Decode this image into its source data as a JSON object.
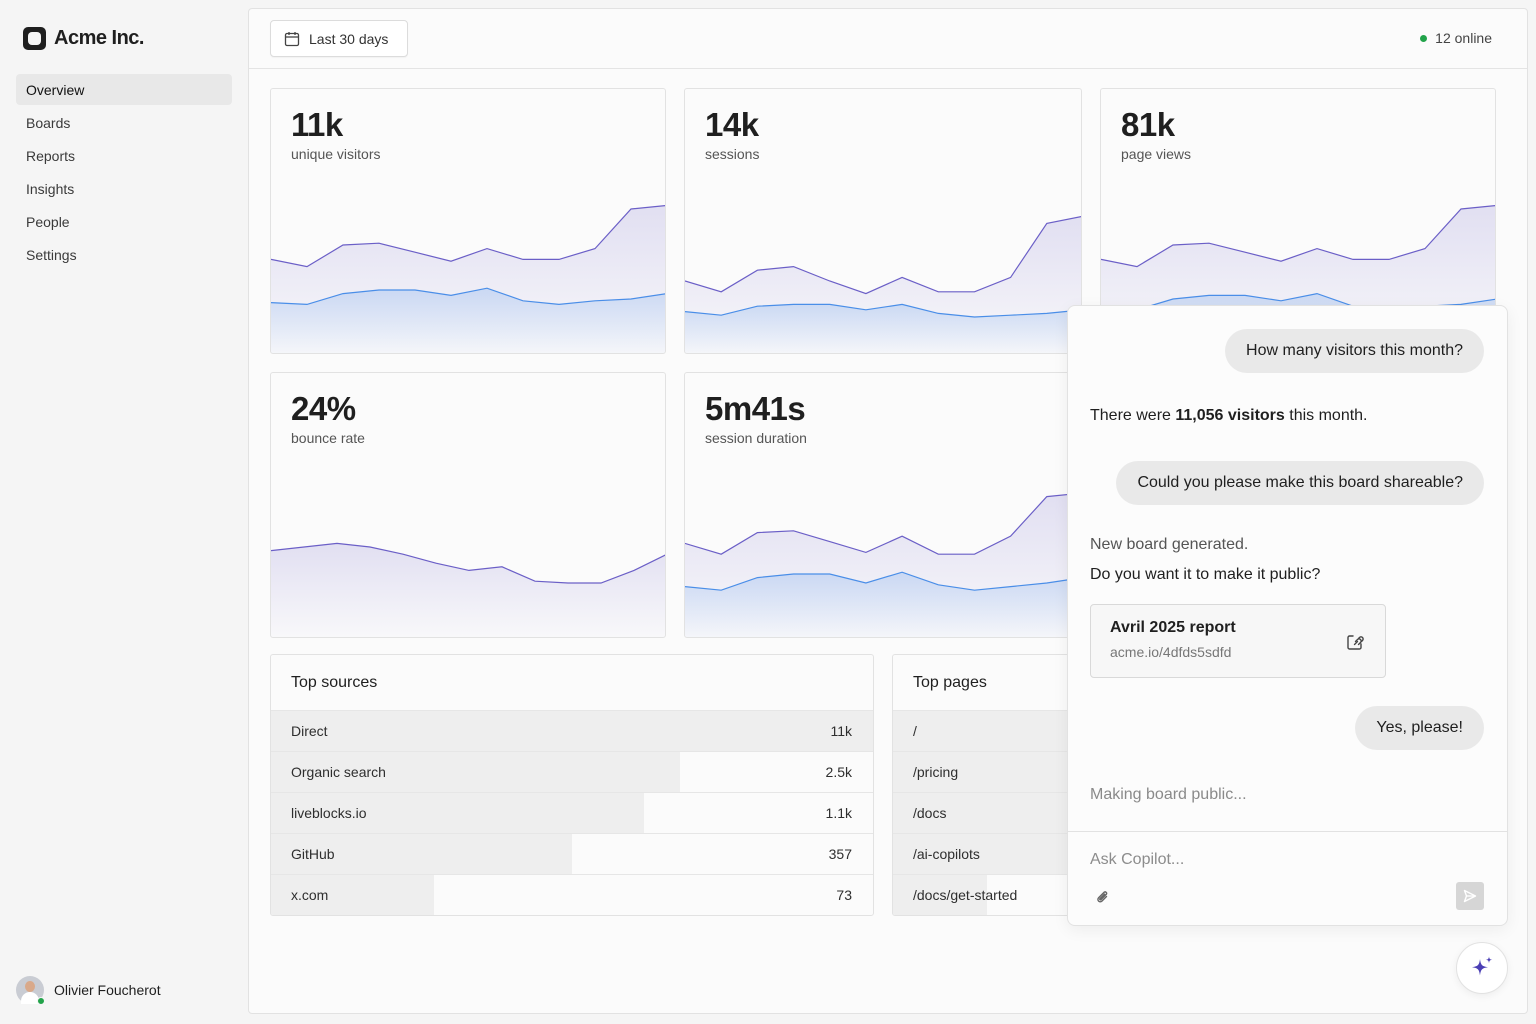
{
  "brand": {
    "name": "Acme Inc."
  },
  "nav": {
    "items": [
      {
        "label": "Overview",
        "active": true
      },
      {
        "label": "Boards"
      },
      {
        "label": "Reports"
      },
      {
        "label": "Insights"
      },
      {
        "label": "People"
      },
      {
        "label": "Settings"
      }
    ]
  },
  "user": {
    "name": "Olivier Foucherot",
    "status": "online"
  },
  "topbar": {
    "date_range": "Last 30 days",
    "online_text": "12 online"
  },
  "colors": {
    "primary_series": "#6b5fc7",
    "secondary_series": "#4a8ee8",
    "online": "#22a34a",
    "accent": "#4b3fb5"
  },
  "metrics": [
    {
      "value": "11k",
      "label": "unique visitors"
    },
    {
      "value": "14k",
      "label": "sessions"
    },
    {
      "value": "81k",
      "label": "page views"
    },
    {
      "value": "24%",
      "label": "bounce rate"
    },
    {
      "value": "5m41s",
      "label": "session duration"
    }
  ],
  "chart_data": [
    {
      "type": "area",
      "name": "unique visitors",
      "series": [
        {
          "values": [
            52,
            48,
            60,
            61,
            56,
            51,
            58,
            52,
            52,
            58,
            80,
            82
          ]
        },
        {
          "values": [
            28,
            27,
            33,
            35,
            35,
            32,
            36,
            29,
            27,
            29,
            30,
            33
          ]
        }
      ]
    },
    {
      "type": "area",
      "name": "sessions",
      "series": [
        {
          "values": [
            40,
            34,
            46,
            48,
            40,
            33,
            42,
            34,
            34,
            42,
            72,
            76
          ]
        },
        {
          "values": [
            23,
            21,
            26,
            27,
            27,
            24,
            27,
            22,
            20,
            21,
            22,
            24
          ]
        }
      ]
    },
    {
      "type": "area",
      "name": "page views",
      "series": [
        {
          "values": [
            52,
            48,
            60,
            61,
            56,
            51,
            58,
            52,
            52,
            58,
            80,
            82
          ]
        },
        {
          "values": [
            25,
            24,
            30,
            32,
            32,
            29,
            33,
            26,
            24,
            26,
            27,
            30
          ]
        }
      ]
    },
    {
      "type": "area",
      "name": "bounce rate",
      "series": [
        {
          "values": [
            48,
            50,
            52,
            50,
            46,
            41,
            37,
            39,
            31,
            30,
            30,
            37,
            46
          ]
        }
      ]
    },
    {
      "type": "area",
      "name": "session duration",
      "series": [
        {
          "values": [
            52,
            46,
            58,
            59,
            53,
            47,
            56,
            46,
            46,
            56,
            78,
            80
          ]
        },
        {
          "values": [
            28,
            26,
            33,
            35,
            35,
            30,
            36,
            29,
            26,
            28,
            30,
            33
          ]
        }
      ]
    }
  ],
  "top_sources": {
    "title": "Top sources",
    "rows": [
      {
        "name": "Direct",
        "value": "11k",
        "fill": 1.0
      },
      {
        "name": "Organic search",
        "value": "2.5k",
        "fill": 0.68
      },
      {
        "name": "liveblocks.io",
        "value": "1.1k",
        "fill": 0.62
      },
      {
        "name": "GitHub",
        "value": "357",
        "fill": 0.5
      },
      {
        "name": "x.com",
        "value": "73",
        "fill": 0.27
      }
    ]
  },
  "top_pages": {
    "title": "Top pages",
    "rows": [
      {
        "name": "/",
        "fill": 1.0
      },
      {
        "name": "/pricing",
        "fill": 1.0
      },
      {
        "name": "/docs",
        "fill": 1.0
      },
      {
        "name": "/ai-copilots",
        "fill": 0.93
      },
      {
        "name": "/docs/get-started",
        "fill": 0.5
      }
    ]
  },
  "copilot": {
    "q1": "How many visitors this month?",
    "a1_prefix": "There were ",
    "a1_bold": "11,056 visitors",
    "a1_suffix": " this month.",
    "q2": "Could you please make this board shareable?",
    "a2_line1": "New board generated.",
    "a2_line2": "Do you want it to make it public?",
    "board": {
      "title": "Avril 2025 report",
      "url": "acme.io/4dfds5sdfd"
    },
    "q3": "Yes, please!",
    "status": "Making board public...",
    "input_placeholder": "Ask Copilot..."
  }
}
